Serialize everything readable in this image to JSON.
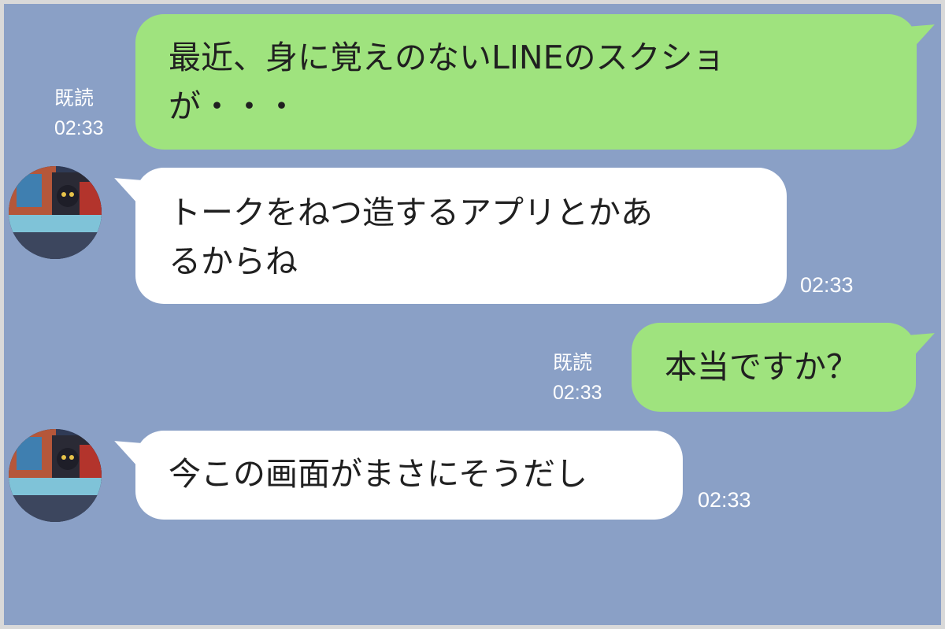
{
  "messages": [
    {
      "direction": "outgoing",
      "lines": [
        "最近、身に覚えのないLINEのスクショ",
        "が・・・"
      ],
      "read_label": "既読",
      "time": "02:33"
    },
    {
      "direction": "incoming",
      "lines": [
        "トークをねつ造するアプリとかあ",
        "るからね"
      ],
      "time": "02:33"
    },
    {
      "direction": "outgoing",
      "lines": [
        "本当ですか？"
      ],
      "read_label": "既読",
      "time": "02:33"
    },
    {
      "direction": "incoming",
      "lines": [
        "今この画面がまさにそうだし"
      ],
      "time": "02:33"
    }
  ],
  "colors": {
    "background": "#8aa0c6",
    "outgoing_bubble": "#9fe37e",
    "incoming_bubble": "#ffffff",
    "meta_text": "#ffffff"
  }
}
